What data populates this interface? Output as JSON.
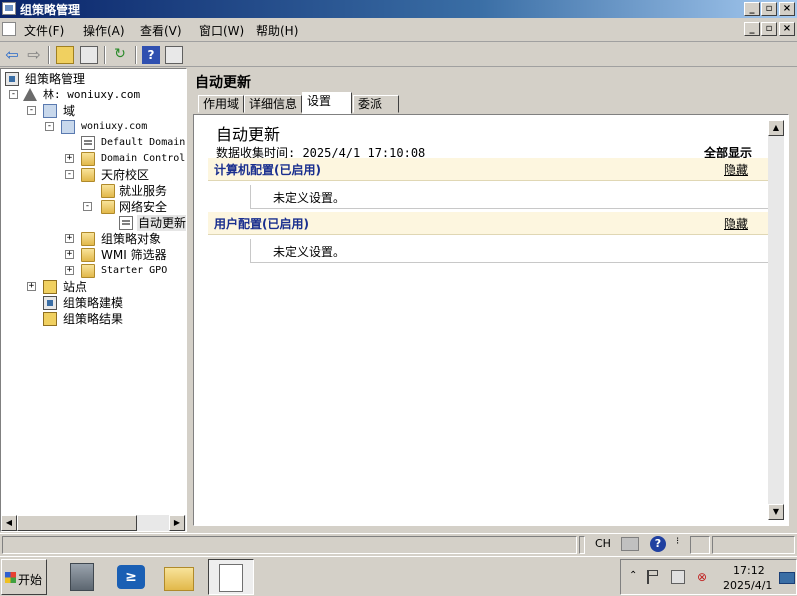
{
  "window": {
    "title": "组策略管理"
  },
  "menu": [
    "文件(F)",
    "操作(A)",
    "查看(V)",
    "窗口(W)",
    "帮助(H)"
  ],
  "tree": {
    "root": "组策略管理",
    "forest": "林: woniuxy.com",
    "domains": "域",
    "domain": "woniuxy.com",
    "default_domain": "Default Domain",
    "domain_controllers": "Domain Control",
    "ou": "天府校区",
    "ou_child1": "就业服务",
    "ou_child2": "网络安全",
    "gpo_link": "自动更新",
    "gpo_objects": "组策略对象",
    "wmi": "WMI 筛选器",
    "starter": "Starter GPO",
    "sites": "站点",
    "modeling": "组策略建模",
    "results": "组策略结果"
  },
  "main": {
    "title": "自动更新",
    "tabs": [
      "作用域",
      "详细信息",
      "设置",
      "委派"
    ],
    "active_tab": "设置",
    "report": {
      "title": "自动更新",
      "date": "数据收集时间: 2025/4/1 17:10:08",
      "show_all": "全部显示",
      "sections": [
        {
          "header": "计算机配置(已启用)",
          "hide": "隐藏",
          "body": "未定义设置。"
        },
        {
          "header": "用户配置(已启用)",
          "hide": "隐藏",
          "body": "未定义设置。"
        }
      ]
    }
  },
  "statusbar": {
    "lang": "CH"
  },
  "taskbar": {
    "start": "开始",
    "time": "17:12",
    "date": "2025/4/1"
  }
}
